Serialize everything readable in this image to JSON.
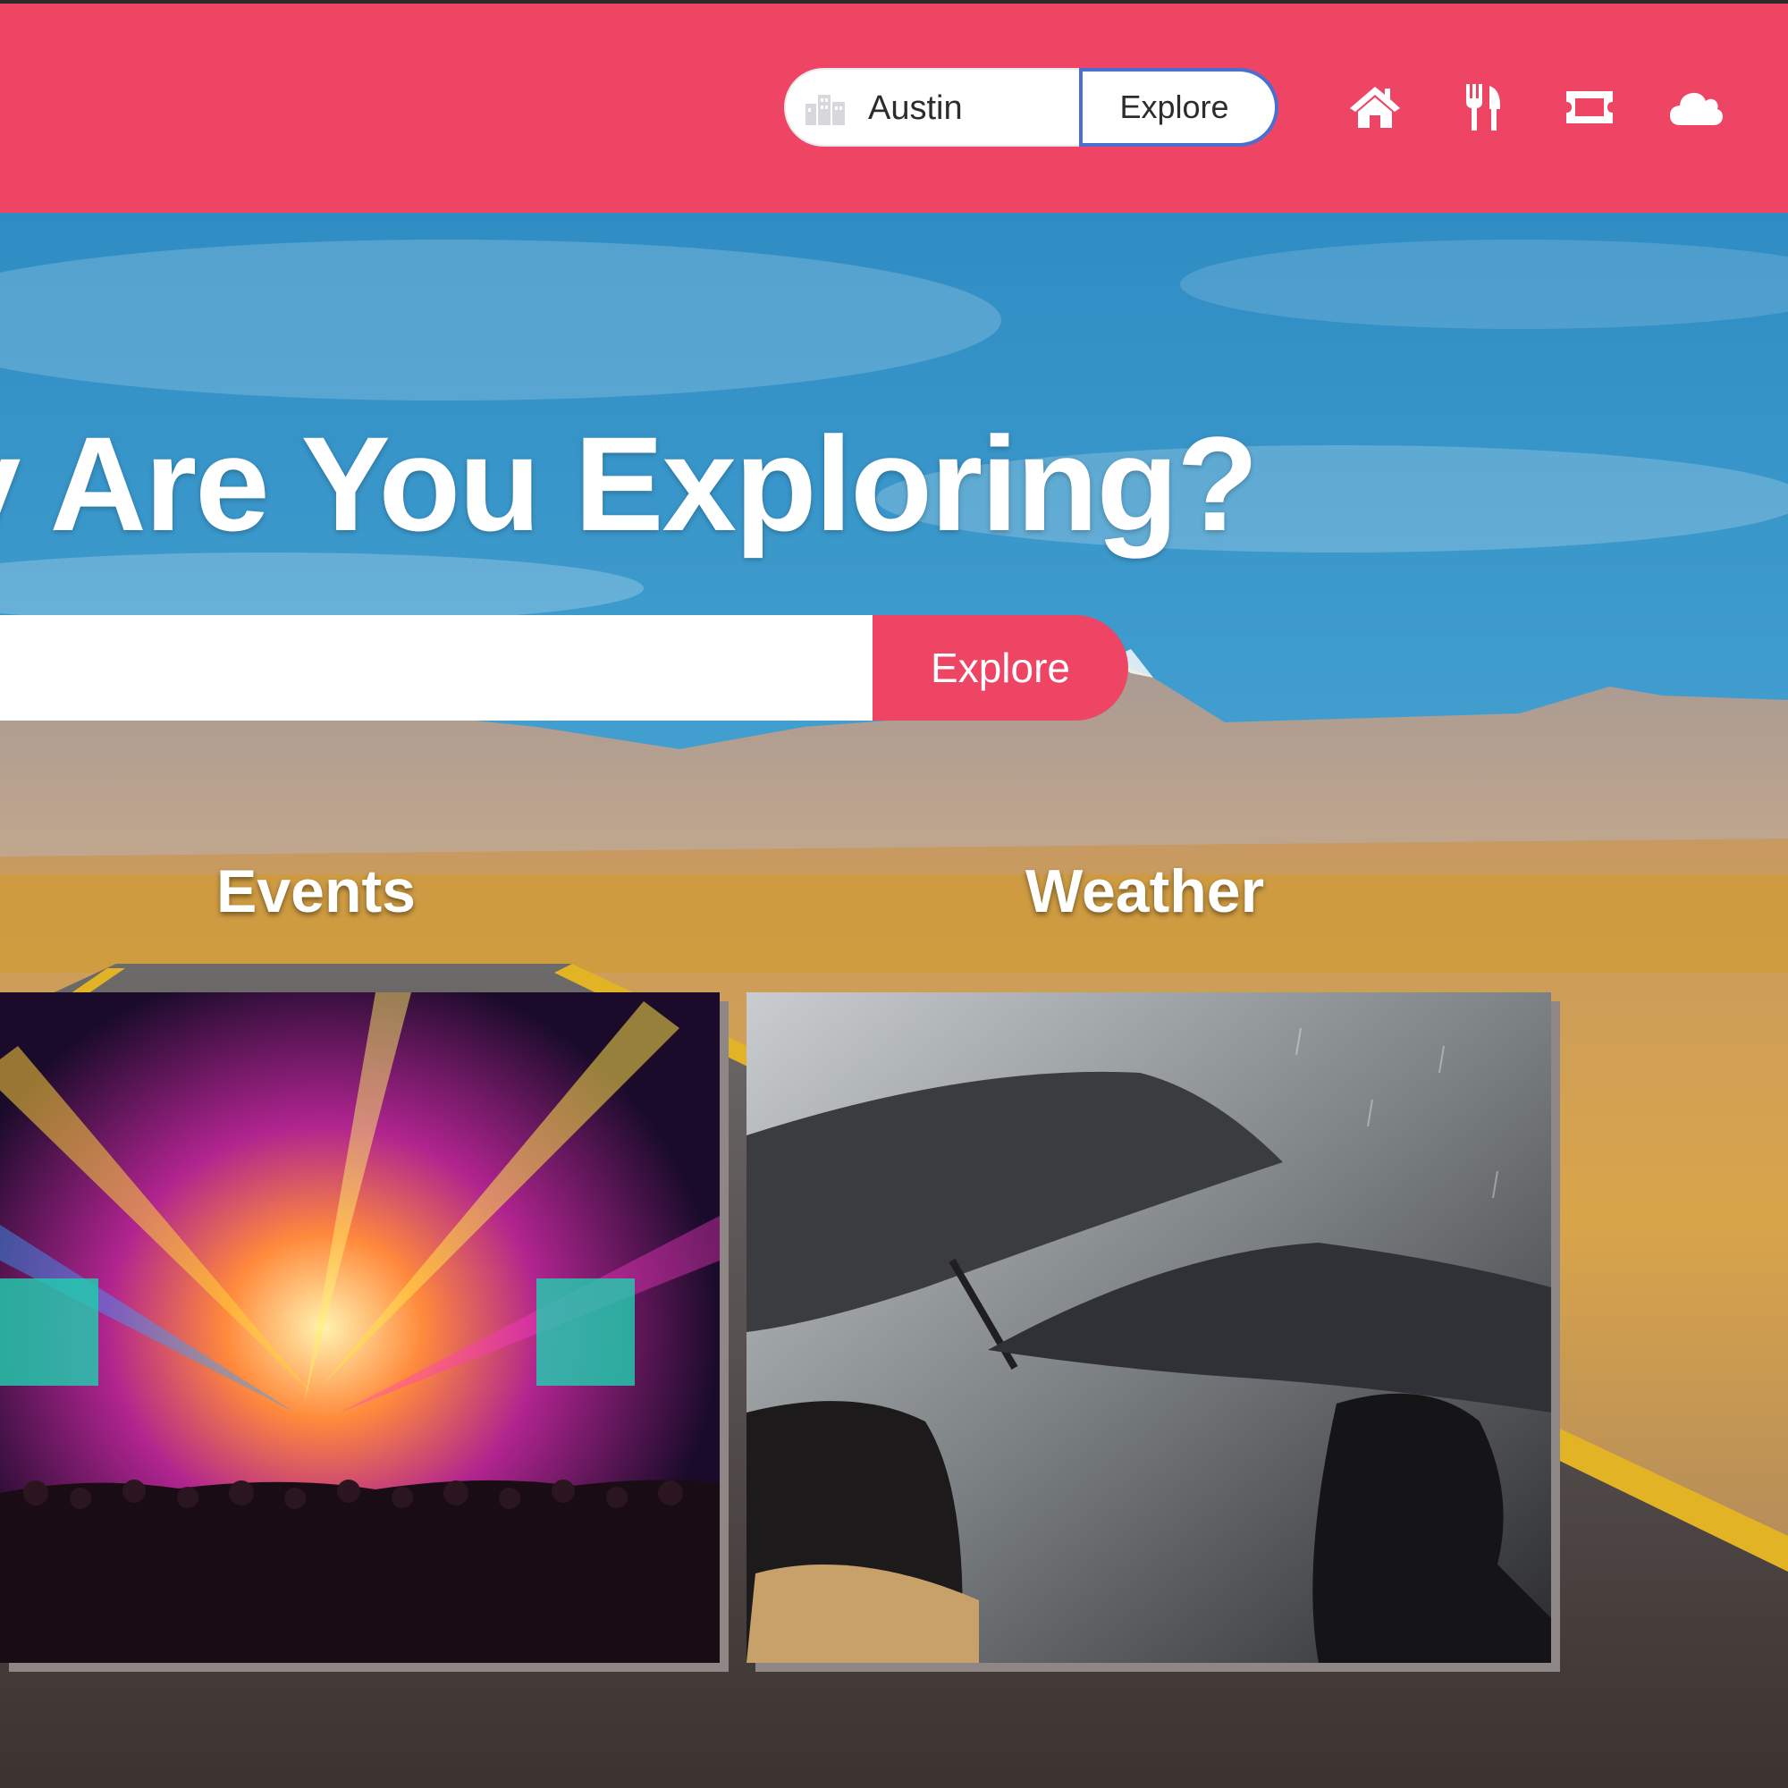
{
  "header": {
    "city_search": {
      "icon": "city-buildings-icon",
      "value": "Austin",
      "button_label": "Explore",
      "button_border_color": "#4a6fd0"
    },
    "nav": [
      {
        "name": "home",
        "icon": "home-icon"
      },
      {
        "name": "restaurants",
        "icon": "fork-knife-icon"
      },
      {
        "name": "tickets",
        "icon": "ticket-icon"
      },
      {
        "name": "weather",
        "icon": "cloud-icon"
      }
    ],
    "background_color": "#ef4565"
  },
  "hero": {
    "title": "y Are You Exploring?",
    "search": {
      "value": "",
      "button_label": "Explore"
    },
    "background": "desert-road-mountains-photo"
  },
  "sections": [
    {
      "label": "Events",
      "image": "concert-stage-lights-photo"
    },
    {
      "label": "Weather",
      "image": "umbrellas-in-rain-photo"
    }
  ],
  "colors": {
    "accent": "#ef4565",
    "card_shadow": "#8f8686"
  }
}
